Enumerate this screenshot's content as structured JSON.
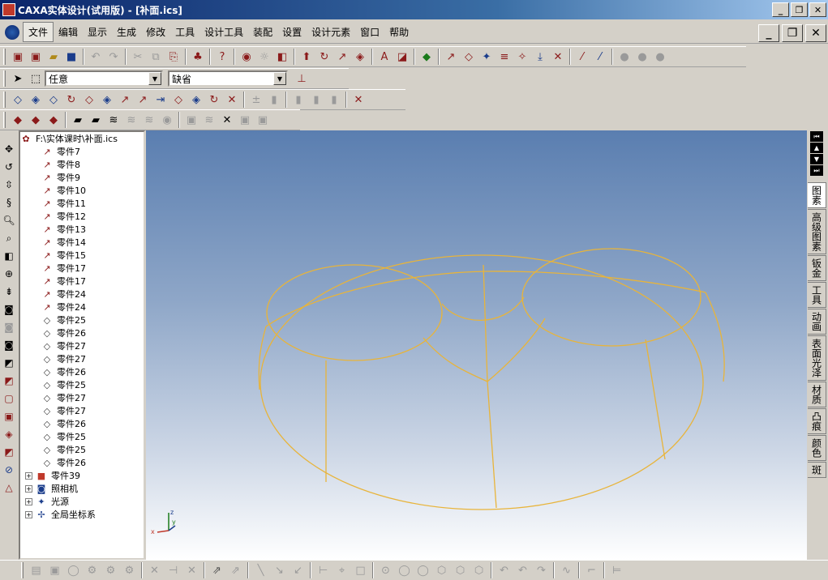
{
  "window": {
    "title": "CAXA实体设计(试用版) - [补面.ics]"
  },
  "menu": [
    "文件",
    "编辑",
    "显示",
    "生成",
    "修改",
    "工具",
    "设计工具",
    "装配",
    "设置",
    "设计元素",
    "窗口",
    "帮助"
  ],
  "selectors": {
    "filter": "任意",
    "mode": "缺省"
  },
  "tree": {
    "root": "F:\\实体课时\\补面.ics",
    "parts": [
      "零件7",
      "零件8",
      "零件9",
      "零件10",
      "零件11",
      "零件12",
      "零件13",
      "零件14",
      "零件15",
      "零件17",
      "零件17",
      "零件24",
      "零件24",
      "零件25",
      "零件26",
      "零件27",
      "零件27",
      "零件26",
      "零件25",
      "零件27",
      "零件27",
      "零件26",
      "零件25",
      "零件25",
      "零件26"
    ],
    "groups": [
      "零件39",
      "照相机",
      "光源",
      "全局坐标系"
    ]
  },
  "right_tabs": [
    "图素",
    "高级图素",
    "钣金",
    "工具",
    "动画",
    "表面光泽",
    "材质",
    "凸痕",
    "颜色",
    "斑"
  ],
  "triad": {
    "x": "x",
    "y": "y",
    "z": "z"
  },
  "colors": {
    "wireframe": "#e8b43a",
    "titlebar": "#0a246a"
  }
}
